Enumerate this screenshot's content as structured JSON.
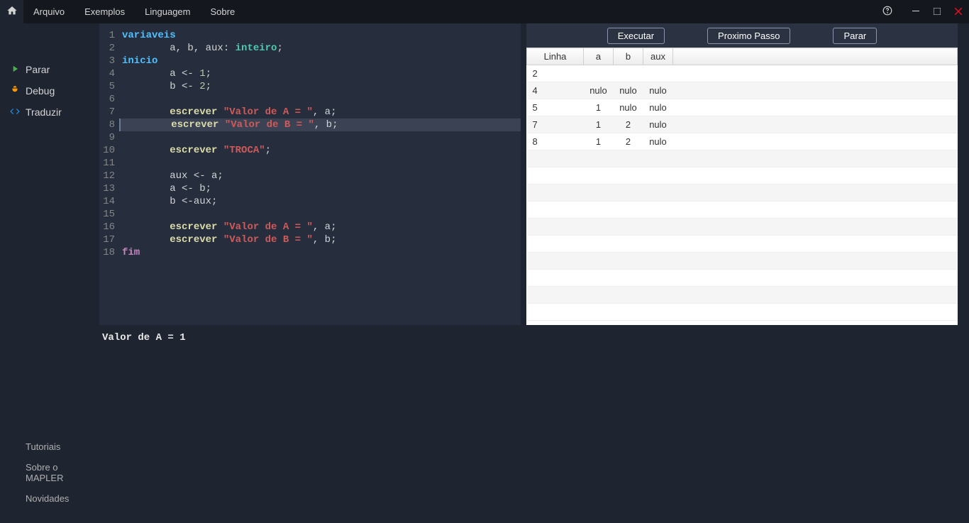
{
  "menu": {
    "arquivo": "Arquivo",
    "exemplos": "Exemplos",
    "linguagem": "Linguagem",
    "sobre": "Sobre"
  },
  "sidebar": {
    "top": {
      "parar": "Parar",
      "debug": "Debug",
      "traduzir": "Traduzir"
    },
    "bottom": {
      "tutoriais": "Tutoriais",
      "sobre_mapler": "Sobre o MAPLER",
      "novidades": "Novidades"
    }
  },
  "editor": {
    "current_line": 8,
    "lines": [
      {
        "n": 1,
        "tokens": [
          {
            "t": "variaveis",
            "c": "kw"
          }
        ]
      },
      {
        "n": 2,
        "tokens": [
          {
            "t": "        a, b, aux: ",
            "c": "op"
          },
          {
            "t": "inteiro",
            "c": "type"
          },
          {
            "t": ";",
            "c": "op"
          }
        ]
      },
      {
        "n": 3,
        "tokens": [
          {
            "t": "inicio",
            "c": "kw"
          }
        ]
      },
      {
        "n": 4,
        "tokens": [
          {
            "t": "        a <- ",
            "c": "op"
          },
          {
            "t": "1",
            "c": "num"
          },
          {
            "t": ";",
            "c": "op"
          }
        ]
      },
      {
        "n": 5,
        "tokens": [
          {
            "t": "        b <- ",
            "c": "op"
          },
          {
            "t": "2",
            "c": "num"
          },
          {
            "t": ";",
            "c": "op"
          }
        ]
      },
      {
        "n": 6,
        "tokens": []
      },
      {
        "n": 7,
        "tokens": [
          {
            "t": "        ",
            "c": "op"
          },
          {
            "t": "escrever",
            "c": "func"
          },
          {
            "t": " ",
            "c": "op"
          },
          {
            "t": "\"Valor de A = \"",
            "c": "str"
          },
          {
            "t": ", a;",
            "c": "op"
          }
        ]
      },
      {
        "n": 8,
        "tokens": [
          {
            "t": "        ",
            "c": "op"
          },
          {
            "t": "escrever",
            "c": "func"
          },
          {
            "t": " ",
            "c": "op"
          },
          {
            "t": "\"Valor de B = \"",
            "c": "str"
          },
          {
            "t": ", b;",
            "c": "op"
          }
        ]
      },
      {
        "n": 9,
        "tokens": []
      },
      {
        "n": 10,
        "tokens": [
          {
            "t": "        ",
            "c": "op"
          },
          {
            "t": "escrever",
            "c": "func"
          },
          {
            "t": " ",
            "c": "op"
          },
          {
            "t": "\"TROCA\"",
            "c": "str"
          },
          {
            "t": ";",
            "c": "op"
          }
        ]
      },
      {
        "n": 11,
        "tokens": []
      },
      {
        "n": 12,
        "tokens": [
          {
            "t": "        aux <- a;",
            "c": "op"
          }
        ]
      },
      {
        "n": 13,
        "tokens": [
          {
            "t": "        a <- b;",
            "c": "op"
          }
        ]
      },
      {
        "n": 14,
        "tokens": [
          {
            "t": "        b <-aux;",
            "c": "op"
          }
        ]
      },
      {
        "n": 15,
        "tokens": []
      },
      {
        "n": 16,
        "tokens": [
          {
            "t": "        ",
            "c": "op"
          },
          {
            "t": "escrever",
            "c": "func"
          },
          {
            "t": " ",
            "c": "op"
          },
          {
            "t": "\"Valor de A = \"",
            "c": "str"
          },
          {
            "t": ", a;",
            "c": "op"
          }
        ]
      },
      {
        "n": 17,
        "tokens": [
          {
            "t": "        ",
            "c": "op"
          },
          {
            "t": "escrever",
            "c": "func"
          },
          {
            "t": " ",
            "c": "op"
          },
          {
            "t": "\"Valor de B = \"",
            "c": "str"
          },
          {
            "t": ", b;",
            "c": "op"
          }
        ]
      },
      {
        "n": 18,
        "tokens": [
          {
            "t": "fim",
            "c": "fim"
          }
        ]
      }
    ]
  },
  "debug": {
    "buttons": {
      "executar": "Executar",
      "proximo": "Proximo Passo",
      "parar": "Parar"
    },
    "headers": {
      "linha": "Linha",
      "a": "a",
      "b": "b",
      "aux": "aux"
    },
    "rows": [
      {
        "linha": "2",
        "a": "",
        "b": "",
        "aux": ""
      },
      {
        "linha": "4",
        "a": "nulo",
        "b": "nulo",
        "aux": "nulo"
      },
      {
        "linha": "5",
        "a": "1",
        "b": "nulo",
        "aux": "nulo"
      },
      {
        "linha": "7",
        "a": "1",
        "b": "2",
        "aux": "nulo"
      },
      {
        "linha": "8",
        "a": "1",
        "b": "2",
        "aux": "nulo"
      }
    ],
    "empty_rows": 10
  },
  "console": {
    "output": "Valor de A = 1"
  }
}
